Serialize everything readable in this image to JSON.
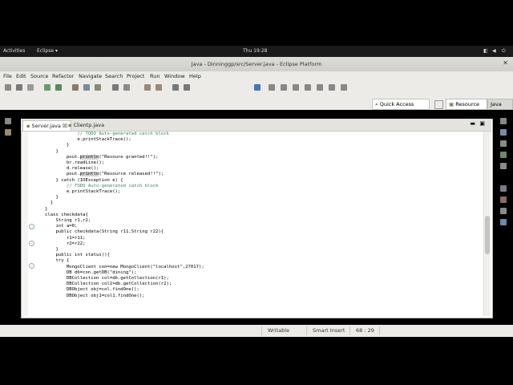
{
  "gnome": {
    "activities": "Activities",
    "app_menu": "Eclipse",
    "clock": "Thu 19:28"
  },
  "window": {
    "title": "Java - Dinninggp/src/Server.java - Eclipse Platform"
  },
  "menu": [
    "File",
    "Edit",
    "Source",
    "Refactor",
    "Navigate",
    "Search",
    "Project",
    "Run",
    "Window",
    "Help"
  ],
  "toolbar": {
    "quick_access": "Quick Access",
    "perspective": "Resource",
    "perspective2": "Java"
  },
  "tabs": [
    {
      "label": "Server.java",
      "close": "☒"
    },
    {
      "label": "Clientp.java"
    }
  ],
  "code": {
    "l1": "            // TODO Auto-generated catch block",
    "l2": "            e.printStackTrace();",
    "l3": "        }",
    "l4": "",
    "l5": "    }",
    "l6": "",
    "l7a": "        pout.",
    "l7b": "println",
    "l7c": "(\"Resoure granted!!\");",
    "l8": "        br.readLine();",
    "l9": "        d.release();",
    "l10a": "        pout.",
    "l10b": "println",
    "l10c": "(\"Resource released!!\");",
    "l11": "    } catch (IOException e) {",
    "l12": "        // TODO Auto-generated catch block",
    "l13": "        e.printStackTrace();",
    "l14": "    }",
    "l15": "  }",
    "l16": "}",
    "l17": "class checkdata{",
    "l18": "    String r1,r2;",
    "l19": "    int a=0;",
    "l20": "    public checkdata(String r11,String r22){",
    "l21": "        r1=r11;",
    "l22": "        r2=r22;",
    "l23": "    }",
    "l24": "    public int status(){",
    "l25": "    try {",
    "l26": "        MongoClient con=new MongoClient(\"localhost\",27017);",
    "l27": "        DB db=con.getDB(\"dining\");",
    "l28": "        DBCollection col=db.getCollection(r1);",
    "l29": "        DBCollection col1=db.getCollection(r2);",
    "l30": "        DBObject obj=col.findOne();",
    "l31": "        DBObject obj1=col1.findOne();"
  },
  "status": {
    "writable": "Writable",
    "insert": "Smart Insert",
    "position": "68 : 29"
  }
}
